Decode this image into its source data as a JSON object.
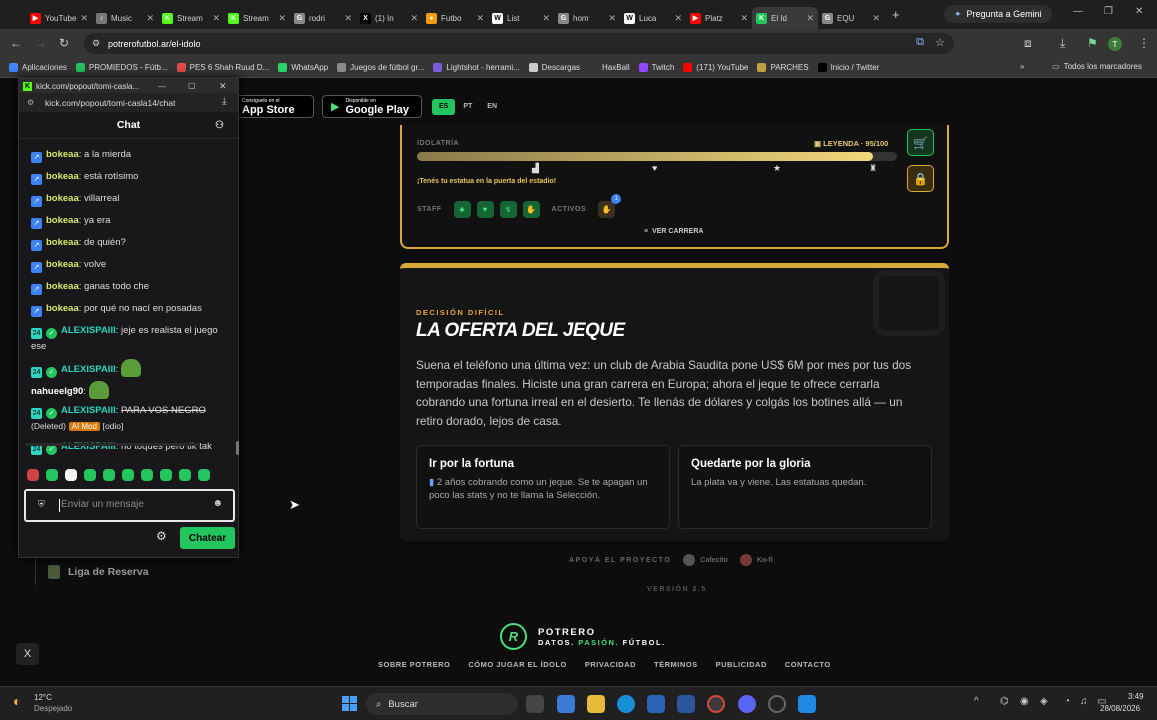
{
  "browser": {
    "tabs": [
      {
        "label": "YouTube",
        "color": "#ff0000",
        "glyph": "▶"
      },
      {
        "label": "Music",
        "color": "#777",
        "glyph": "♪"
      },
      {
        "label": "Stream",
        "color": "#53fc18",
        "glyph": "K"
      },
      {
        "label": "Stream",
        "color": "#53fc18",
        "glyph": "K"
      },
      {
        "label": "rodri",
        "color": "#888",
        "glyph": "G"
      },
      {
        "label": "(1) In",
        "color": "#000",
        "glyph": "X"
      },
      {
        "label": "Futbo",
        "color": "#f59e0b",
        "glyph": "●"
      },
      {
        "label": "List",
        "color": "#fff",
        "glyph": "W"
      },
      {
        "label": "hom",
        "color": "#888",
        "glyph": "G"
      },
      {
        "label": "Luca",
        "color": "#fff",
        "glyph": "W"
      },
      {
        "label": "Platz",
        "color": "#ff0000",
        "glyph": "▶"
      },
      {
        "label": "El Id",
        "color": "#22c55e",
        "glyph": "K"
      },
      {
        "label": "EQU",
        "color": "#888",
        "glyph": "G"
      }
    ],
    "gemini_label": "Pregunta a Gemini",
    "url": "potrerofutbol.ar/el-idolo",
    "bookmarks": [
      "Aplicaciones",
      "PROMIEDOS - Fútb...",
      "PES 6 Shah Ruud D...",
      "WhatsApp",
      "Juegos de fútbol gr...",
      "Lightshot - herrami...",
      "Descargas",
      "HaxBall",
      "Twitch",
      "(171) YouTube",
      "PARCHES",
      "Inicio / Twitter"
    ],
    "all_bookmarks": "Todos los marcadores"
  },
  "popup": {
    "title": "kick.com/popout/tomi-casla...",
    "url": "kick.com/popout/tomi-casla14/chat",
    "chat_title": "Chat",
    "messages": [
      {
        "user": "bokeaa",
        "text": "a la mierda"
      },
      {
        "user": "bokeaa",
        "text": "está rotísimo"
      },
      {
        "user": "bokeaa",
        "text": "villarreal"
      },
      {
        "user": "bokeaa",
        "text": "ya era"
      },
      {
        "user": "bokeaa",
        "text": "de quién?"
      },
      {
        "user": "bokeaa",
        "text": "volve"
      },
      {
        "user": "bokeaa",
        "text": "ganas todo che"
      },
      {
        "user": "bokeaa",
        "text": "por qué no nací en posadas"
      },
      {
        "user": "ALEXISPAIII",
        "text": "jeje es realista el juego ese"
      },
      {
        "user": "ALEXISPAIII",
        "text": ""
      },
      {
        "user": "nahueelg90",
        "text": ""
      },
      {
        "user": "ALEXISPAIII",
        "text": "PARA VOS NEGRO"
      },
      {
        "user": "ALEXISPAIII",
        "text": "no toques pero tik tak"
      }
    ],
    "deleted": "(Deleted)",
    "ai_mod": "AI Mod",
    "ai_mod_reason": "[odio]",
    "placeholder": "Enviar un mensaje",
    "send_label": "Chatear",
    "below_popup": "Liga de Reserva"
  },
  "stores": {
    "app_store_small": "Consíguelo en el",
    "app_store": "App Store",
    "google_small": "Disponible en",
    "google": "Google Play",
    "langs": [
      "ES",
      "PT",
      "EN"
    ]
  },
  "idolatria": {
    "label": "IDOLATRÍA",
    "level": "LEYENDA · 95/100",
    "progress": 0.95,
    "note": "¡Tenés tu estatua en la puerta del estadio!",
    "staff_label": "STAFF",
    "activos_label": "ACTIVOS",
    "activos_count": "1",
    "career_button": "VER CARRERA"
  },
  "decision": {
    "kicker": "DECISIÓN DIFÍCIL",
    "title": "LA OFERTA DEL JEQUE",
    "body": "Suena el teléfono una última vez: un club de Arabia Saudita pone US$ 6M por mes por tus dos temporadas finales. Hiciste una gran carrera en Europa; ahora el jeque te ofrece cerrarla cobrando una fortuna irreal en el desierto. Te llenás de dólares y colgás los botines allá — un retiro dorado, lejos de casa.",
    "option1_title": "Ir por la fortuna",
    "option1_desc": "2 años cobrando como un jeque. Se te apagan un poco las stats y no te llama la Selección.",
    "option2_title": "Quedarte por la gloria",
    "option2_desc": "La plata va y viene. Las estatuas quedan."
  },
  "support": {
    "label": "APOYÁ EL PROYECTO",
    "cafecito": "Cafecito",
    "kofi": "Ko-fi"
  },
  "version": "VERSIÓN 2.5",
  "brand": {
    "name": "POTRERO",
    "tag_a": "DATOS.",
    "tag_b": "PASIÓN.",
    "tag_c": "FÚTBOL."
  },
  "footer_links": [
    "SOBRE POTRERO",
    "CÓMO JUGAR EL ÍDOLO",
    "PRIVACIDAD",
    "TÉRMINOS",
    "PUBLICIDAD",
    "CONTACTO"
  ],
  "taskbar": {
    "temp": "12°C",
    "weather": "Despejado",
    "search": "Buscar",
    "time": "3:49",
    "date": "28/08/2026"
  }
}
